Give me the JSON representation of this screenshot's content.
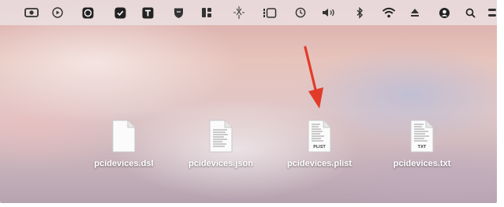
{
  "menubar": {
    "icons": [
      "screenshot-icon",
      "play-circle-icon",
      "app-badge-icon",
      "shield-check-icon",
      "text-app-icon",
      "security-shield-icon",
      "window-layout-icon",
      "voice-control-icon",
      "stage-manager-icon",
      "time-machine-icon",
      "volume-icon",
      "bluetooth-icon",
      "wifi-icon",
      "eject-icon",
      "user-account-icon",
      "search-icon",
      "control-center-icon"
    ]
  },
  "desktop": {
    "files": [
      {
        "name": "pcidevices.dsl",
        "icon": "blank-document-icon"
      },
      {
        "name": "pcidevices.json",
        "icon": "text-document-icon"
      },
      {
        "name": "pcidevices.plist",
        "icon": "plist-document-icon",
        "tag": "PLIST"
      },
      {
        "name": "pcidevices.txt",
        "icon": "txt-document-icon",
        "tag": "TXT"
      }
    ],
    "annotation": {
      "icon": "red-arrow-icon",
      "color": "#e23b2a",
      "points_to": "pcidevices.plist"
    }
  }
}
